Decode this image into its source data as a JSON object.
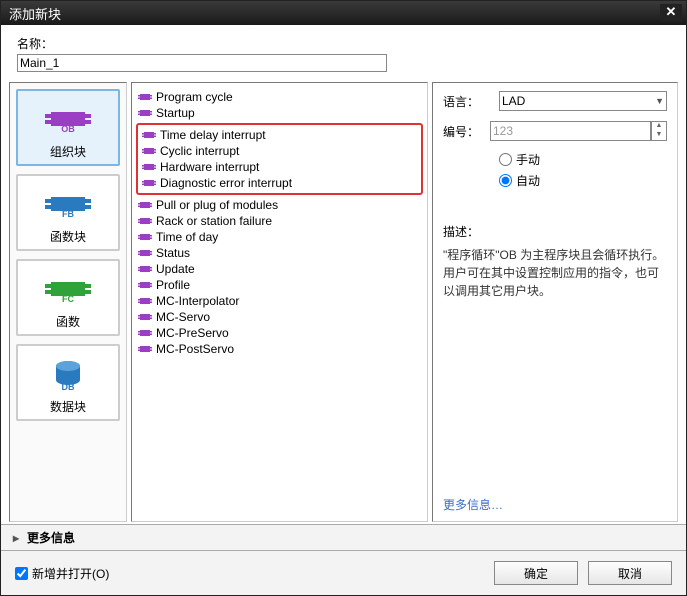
{
  "dialog": {
    "title": "添加新块",
    "close": "✕"
  },
  "name": {
    "label": "名称：",
    "value": "Main_1"
  },
  "blockTypes": {
    "ob": {
      "code": "OB",
      "label": "组织块",
      "color": "#9a3fc3"
    },
    "fb": {
      "code": "FB",
      "label": "函数块",
      "color": "#2a7abf"
    },
    "fc": {
      "code": "FC",
      "label": "函数",
      "color": "#2fa23a"
    },
    "db": {
      "code": "DB",
      "label": "数据块",
      "color": "#2a7abf"
    }
  },
  "obList": {
    "pre": [
      "Program cycle",
      "Startup"
    ],
    "highlighted": [
      "Time delay interrupt",
      "Cyclic interrupt",
      "Hardware interrupt",
      "Diagnostic error interrupt"
    ],
    "post": [
      "Pull or plug of modules",
      "Rack or station failure",
      "Time of day",
      "Status",
      "Update",
      "Profile",
      "MC-Interpolator",
      "MC-Servo",
      "MC-PreServo",
      "MC-PostServo"
    ]
  },
  "right": {
    "langLabel": "语言：",
    "langValue": "LAD",
    "numLabel": "编号：",
    "numValue": "123",
    "manual": "手动",
    "auto": "自动",
    "descLabel": "描述：",
    "descText": "\"程序循环\"OB 为主程序块且会循环执行。用户可在其中设置控制应用的指令，也可以调用其它用户块。",
    "moreInfo": "更多信息…"
  },
  "moreInfoBar": "更多信息",
  "footer": {
    "addOpen": "新增并打开(O)",
    "ok": "确定",
    "cancel": "取消"
  }
}
